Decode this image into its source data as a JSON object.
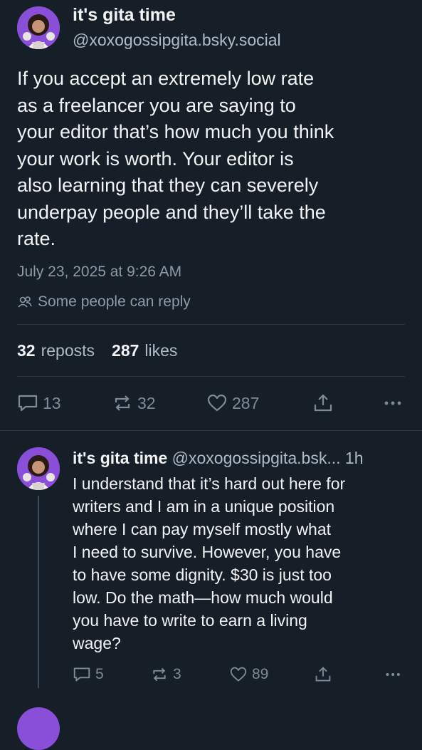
{
  "post": {
    "author_name": "it's gita time",
    "handle": "@xoxogossipgita.bsky.social",
    "text": "If you accept an extremely low rate\nas a freelancer you are saying to\nyour editor that’s how much you think\nyour work is worth. Your editor is\nalso learning that they can severely\nunderpay people and they’ll take the\nrate.",
    "date": "July 23, 2025 at 9:26 AM",
    "reply_setting": "Some people can reply",
    "reposts_count": "32",
    "reposts_label": "reposts",
    "likes_count": "287",
    "likes_label": "likes",
    "actions": {
      "replies": "13",
      "reposts": "32",
      "likes": "287"
    }
  },
  "reply": {
    "author_name": "it's gita time",
    "handle": "@xoxogossipgita.bsk...",
    "time": "1h",
    "text": "I understand that it’s hard out here for\nwriters and I am in a unique position\nwhere I can pay myself mostly what\nI need to survive. However, you have\nto have some dignity. $30 is just too\nlow. Do the math—how much would\nyou have to write to earn a living\nwage?",
    "actions": {
      "replies": "5",
      "reposts": "3",
      "likes": "89"
    }
  },
  "icons": {
    "reply": "speech-bubble-icon",
    "repost": "repost-arrows-icon",
    "like": "heart-icon",
    "share": "share-upload-icon",
    "more": "ellipsis-icon",
    "reply_setting": "people-icon"
  },
  "colors": {
    "background": "#161e27",
    "text_primary": "#f1f3f5",
    "text_secondary": "#aebbc9",
    "text_muted": "#8c9aa9",
    "avatar_bg": "#8a4fd8",
    "divider": "#2b3642"
  }
}
